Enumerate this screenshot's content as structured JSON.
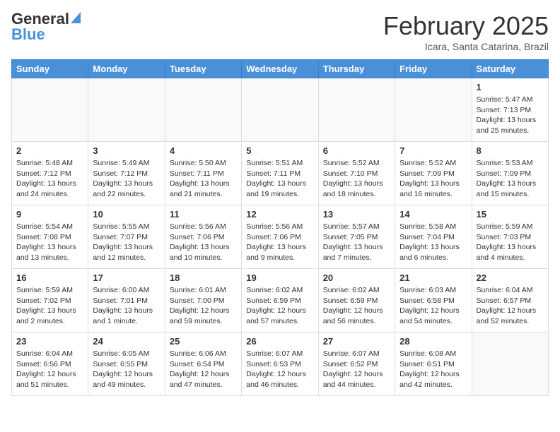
{
  "header": {
    "logo_general": "General",
    "logo_blue": "Blue",
    "month_year": "February 2025",
    "location": "Icara, Santa Catarina, Brazil"
  },
  "weekdays": [
    "Sunday",
    "Monday",
    "Tuesday",
    "Wednesday",
    "Thursday",
    "Friday",
    "Saturday"
  ],
  "weeks": [
    [
      {
        "day": "",
        "info": ""
      },
      {
        "day": "",
        "info": ""
      },
      {
        "day": "",
        "info": ""
      },
      {
        "day": "",
        "info": ""
      },
      {
        "day": "",
        "info": ""
      },
      {
        "day": "",
        "info": ""
      },
      {
        "day": "1",
        "info": "Sunrise: 5:47 AM\nSunset: 7:13 PM\nDaylight: 13 hours\nand 25 minutes."
      }
    ],
    [
      {
        "day": "2",
        "info": "Sunrise: 5:48 AM\nSunset: 7:12 PM\nDaylight: 13 hours\nand 24 minutes."
      },
      {
        "day": "3",
        "info": "Sunrise: 5:49 AM\nSunset: 7:12 PM\nDaylight: 13 hours\nand 22 minutes."
      },
      {
        "day": "4",
        "info": "Sunrise: 5:50 AM\nSunset: 7:11 PM\nDaylight: 13 hours\nand 21 minutes."
      },
      {
        "day": "5",
        "info": "Sunrise: 5:51 AM\nSunset: 7:11 PM\nDaylight: 13 hours\nand 19 minutes."
      },
      {
        "day": "6",
        "info": "Sunrise: 5:52 AM\nSunset: 7:10 PM\nDaylight: 13 hours\nand 18 minutes."
      },
      {
        "day": "7",
        "info": "Sunrise: 5:52 AM\nSunset: 7:09 PM\nDaylight: 13 hours\nand 16 minutes."
      },
      {
        "day": "8",
        "info": "Sunrise: 5:53 AM\nSunset: 7:09 PM\nDaylight: 13 hours\nand 15 minutes."
      }
    ],
    [
      {
        "day": "9",
        "info": "Sunrise: 5:54 AM\nSunset: 7:08 PM\nDaylight: 13 hours\nand 13 minutes."
      },
      {
        "day": "10",
        "info": "Sunrise: 5:55 AM\nSunset: 7:07 PM\nDaylight: 13 hours\nand 12 minutes."
      },
      {
        "day": "11",
        "info": "Sunrise: 5:56 AM\nSunset: 7:06 PM\nDaylight: 13 hours\nand 10 minutes."
      },
      {
        "day": "12",
        "info": "Sunrise: 5:56 AM\nSunset: 7:06 PM\nDaylight: 13 hours\nand 9 minutes."
      },
      {
        "day": "13",
        "info": "Sunrise: 5:57 AM\nSunset: 7:05 PM\nDaylight: 13 hours\nand 7 minutes."
      },
      {
        "day": "14",
        "info": "Sunrise: 5:58 AM\nSunset: 7:04 PM\nDaylight: 13 hours\nand 6 minutes."
      },
      {
        "day": "15",
        "info": "Sunrise: 5:59 AM\nSunset: 7:03 PM\nDaylight: 13 hours\nand 4 minutes."
      }
    ],
    [
      {
        "day": "16",
        "info": "Sunrise: 5:59 AM\nSunset: 7:02 PM\nDaylight: 13 hours\nand 2 minutes."
      },
      {
        "day": "17",
        "info": "Sunrise: 6:00 AM\nSunset: 7:01 PM\nDaylight: 13 hours\nand 1 minute."
      },
      {
        "day": "18",
        "info": "Sunrise: 6:01 AM\nSunset: 7:00 PM\nDaylight: 12 hours\nand 59 minutes."
      },
      {
        "day": "19",
        "info": "Sunrise: 6:02 AM\nSunset: 6:59 PM\nDaylight: 12 hours\nand 57 minutes."
      },
      {
        "day": "20",
        "info": "Sunrise: 6:02 AM\nSunset: 6:59 PM\nDaylight: 12 hours\nand 56 minutes."
      },
      {
        "day": "21",
        "info": "Sunrise: 6:03 AM\nSunset: 6:58 PM\nDaylight: 12 hours\nand 54 minutes."
      },
      {
        "day": "22",
        "info": "Sunrise: 6:04 AM\nSunset: 6:57 PM\nDaylight: 12 hours\nand 52 minutes."
      }
    ],
    [
      {
        "day": "23",
        "info": "Sunrise: 6:04 AM\nSunset: 6:56 PM\nDaylight: 12 hours\nand 51 minutes."
      },
      {
        "day": "24",
        "info": "Sunrise: 6:05 AM\nSunset: 6:55 PM\nDaylight: 12 hours\nand 49 minutes."
      },
      {
        "day": "25",
        "info": "Sunrise: 6:06 AM\nSunset: 6:54 PM\nDaylight: 12 hours\nand 47 minutes."
      },
      {
        "day": "26",
        "info": "Sunrise: 6:07 AM\nSunset: 6:53 PM\nDaylight: 12 hours\nand 46 minutes."
      },
      {
        "day": "27",
        "info": "Sunrise: 6:07 AM\nSunset: 6:52 PM\nDaylight: 12 hours\nand 44 minutes."
      },
      {
        "day": "28",
        "info": "Sunrise: 6:08 AM\nSunset: 6:51 PM\nDaylight: 12 hours\nand 42 minutes."
      },
      {
        "day": "",
        "info": ""
      }
    ]
  ]
}
